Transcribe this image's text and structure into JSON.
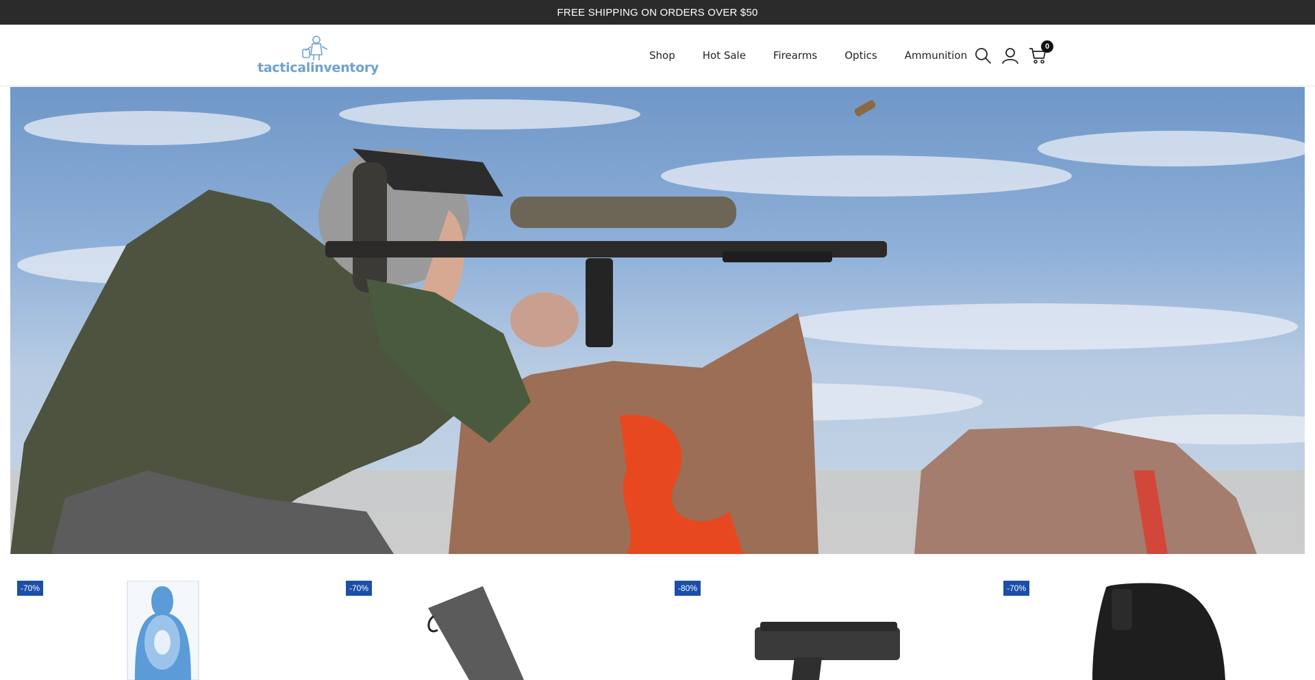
{
  "announcement": {
    "text": "FREE SHIPPING ON ORDERS OVER $50"
  },
  "header": {
    "logo_text": "tacticalinventory",
    "nav": [
      {
        "label": "Shop"
      },
      {
        "label": "Hot Sale"
      },
      {
        "label": "Firearms"
      },
      {
        "label": "Optics"
      },
      {
        "label": "Ammunition"
      }
    ],
    "icons": [
      "search-icon",
      "account-icon",
      "cart-icon"
    ],
    "cart_count": "0"
  },
  "hero": {
    "image": "man aiming a scoped rifle resting on a rock under a cloudy blue sky"
  },
  "products": [
    {
      "badge": "-70%",
      "image": "paper silhouette target"
    },
    {
      "badge": "-70%",
      "image": "rifle buttstock"
    },
    {
      "badge": "-80%",
      "image": "pistol"
    },
    {
      "badge": "-70%",
      "image": "black holster"
    }
  ],
  "colors": {
    "announce_bg": "#2b2b2b",
    "badge_bg": "#1b4fa8",
    "logo": "#6fa0cf"
  }
}
